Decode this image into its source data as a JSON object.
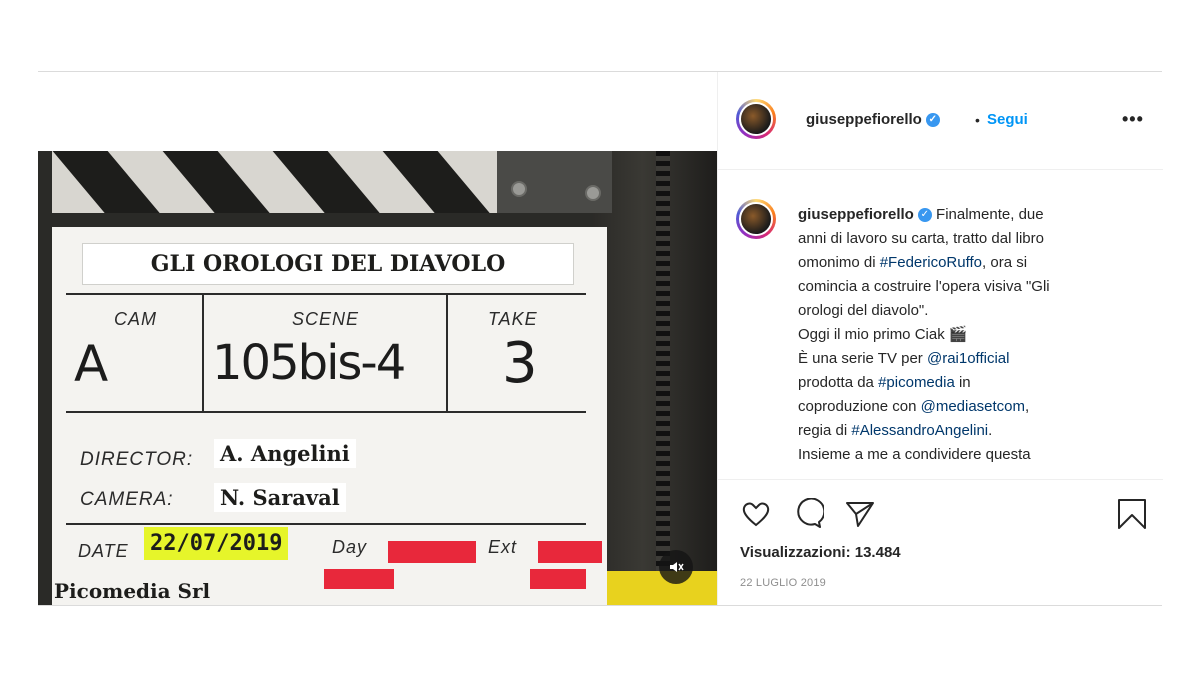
{
  "post": {
    "username": "giuseppefiorello",
    "follow_label": "Segui",
    "separator": "•",
    "more_label": "•••",
    "caption_lines": [
      "Finalmente, due",
      "anni di lavoro su carta, tratto dal libro",
      "omonimo di",
      "#FedericoRuffo",
      ", ora si",
      "comincia a costruire l'opera visiva \"Gli",
      "orologi del diavolo\".",
      "Oggi il mio primo Ciak 🎬",
      "È una serie TV per",
      "@rai1official",
      "prodotta da",
      "#picomedia",
      "in",
      "coproduzione con",
      "@mediasetcom",
      ",",
      "regia di",
      "#AlessandroAngelini",
      ".",
      "Insieme a me a condividere questa"
    ],
    "views_label": "Visualizzazioni: 13.484",
    "date": "22 LUGLIO 2019"
  },
  "clapper": {
    "title": "GLI OROLOGI DEL DIAVOLO",
    "cam_label": "CAM",
    "scene_label": "SCENE",
    "take_label": "TAKE",
    "cam_value": "A",
    "scene_value": "105bis-4",
    "take_value": "3",
    "director_label": "DIRECTOR:",
    "director_value": "A. Angelini",
    "camera_label": "CAMERA:",
    "camera_value": "N. Saraval",
    "date_label": "DATE",
    "date_value": "22/07/2019",
    "day_label": "Day",
    "ext_label": "Ext",
    "company": "Picomedia Srl"
  },
  "icons": {
    "verified": "verified-badge-icon",
    "mute": "mute-icon",
    "like": "heart-icon",
    "comment": "comment-icon",
    "share": "send-icon",
    "save": "bookmark-icon"
  },
  "colors": {
    "link": "#00376b",
    "follow": "#0095f6",
    "verified": "#3897f0",
    "sticker": "#e6f52a",
    "tape": "#e8283b"
  }
}
